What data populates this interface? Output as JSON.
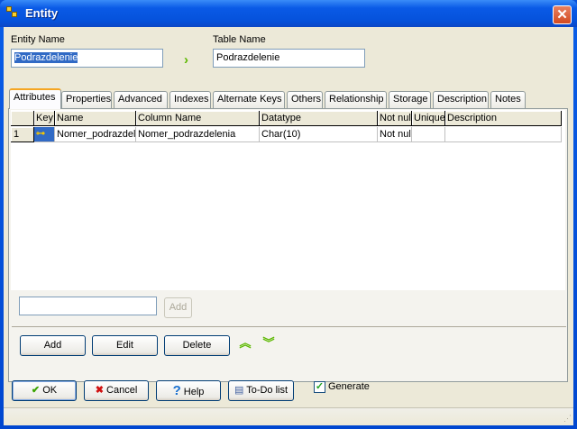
{
  "window": {
    "title": "Entity",
    "close_label": "✕"
  },
  "entity_name": {
    "label": "Entity Name",
    "value": "Podrazdelenie"
  },
  "table_name": {
    "label": "Table Name",
    "value": "Podrazdelenie"
  },
  "tabs": [
    "Attributes",
    "Properties",
    "Advanced",
    "Indexes",
    "Alternate Keys",
    "Others",
    "Relationship",
    "Storage",
    "Description",
    "Notes"
  ],
  "grid": {
    "columns": [
      "Key",
      "Name",
      "Column Name",
      "Datatype",
      "Not nul",
      "Unique",
      "Description"
    ],
    "rows": [
      {
        "num": "1",
        "key": "key-icon",
        "name": "Nomer_podrazdele",
        "column_name": "Nomer_podrazdelenia",
        "datatype": "Char(10)",
        "not_null": "Not nul",
        "unique": "",
        "description": ""
      }
    ]
  },
  "quick_add": {
    "value": "",
    "button": "Add"
  },
  "actions": {
    "add": "Add",
    "edit": "Edit",
    "delete": "Delete",
    "move_up": "⌃",
    "move_down": "⌄"
  },
  "footer": {
    "ok": "OK",
    "cancel": "Cancel",
    "help": "Help",
    "todo": "To-Do list",
    "generate": "Generate",
    "generate_checked": true
  },
  "colors": {
    "accent": "#316ac5",
    "arrow": "#5cb800"
  }
}
